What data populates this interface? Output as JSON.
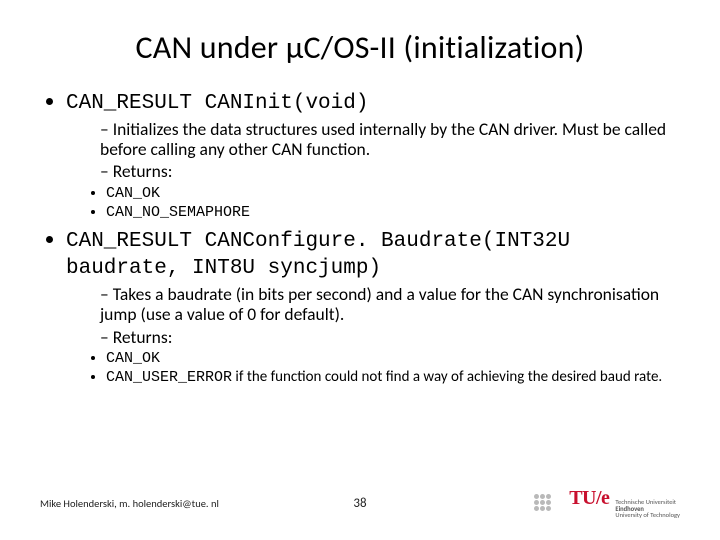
{
  "title": "CAN under μC/OS-II (initialization)",
  "items": [
    {
      "sig": "CAN_RESULT CANInit(void)",
      "desc": "Initializes the data structures used internally by the CAN driver. Must be called before calling any other CAN function.",
      "returns_label": "Returns:",
      "returns": [
        {
          "code": "CAN_OK",
          "suffix": ""
        },
        {
          "code": "CAN_NO_SEMAPHORE",
          "suffix": ""
        }
      ]
    },
    {
      "sig": "CAN_RESULT CANConfigure. Baudrate(INT32U baudrate, INT8U syncjump)",
      "desc": "Takes a baudrate (in bits per second) and a value for the CAN synchronisation jump (use a value of 0 for default).",
      "returns_label": "Returns:",
      "returns": [
        {
          "code": "CAN_OK",
          "suffix": ""
        },
        {
          "code": "CAN_USER_ERROR",
          "suffix": " if the function could not find a way of achieving the desired baud rate."
        }
      ]
    }
  ],
  "footer": {
    "author": "Mike Holenderski, m. holenderski@tue. nl",
    "page": "38",
    "tue_mark": "TU/e",
    "tue_line1": "Technische Universiteit",
    "tue_line2_a": "Eindhoven",
    "tue_line2_b": "University of Technology"
  }
}
